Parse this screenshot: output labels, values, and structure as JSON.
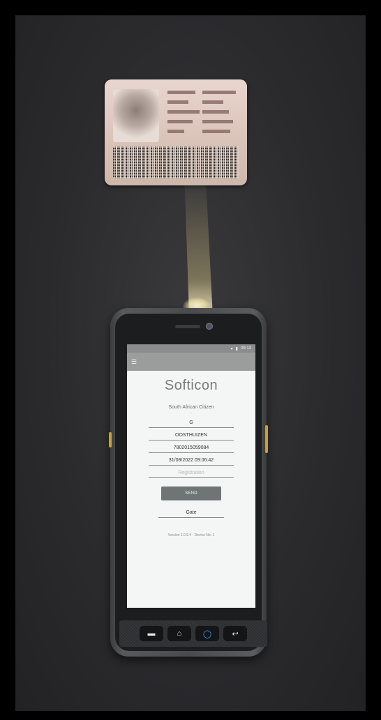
{
  "phone_app": {
    "status_time": "09:13",
    "logo_text": "Softicon",
    "citizenship": "South African Citizen",
    "separator": "-",
    "fields": {
      "initials": "G",
      "surname": "OOSTHUIZEN",
      "id_number": "7802015059084",
      "timestamp": "31/08/2022 09:06:42",
      "registration_placeholder": "Registration"
    },
    "send_label": "SEND",
    "gate_value": "Gate",
    "version_text": "Version 1.0.5.4 - Device No. 1"
  },
  "icons": {
    "menu": "hamburger-icon",
    "nav_left": "recent-apps-icon",
    "nav_home": "home-icon",
    "nav_center": "scan-icon",
    "nav_back": "back-icon"
  },
  "colors": {
    "app_bar": "#9b9c9c",
    "send_button": "#6f7475",
    "scan_accent": "#3aa0ff",
    "beam": "#fff0b4"
  }
}
